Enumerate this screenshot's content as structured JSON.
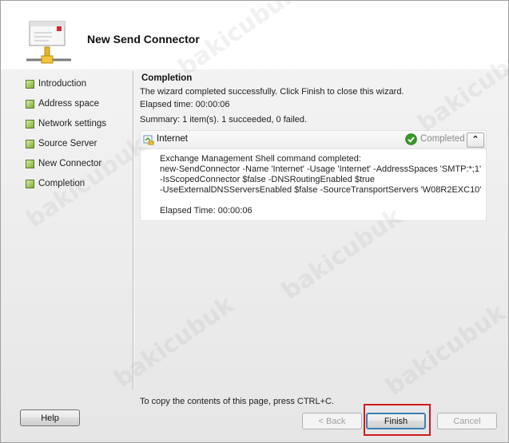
{
  "window": {
    "title": "New Send Connector"
  },
  "steps": [
    {
      "label": "Introduction"
    },
    {
      "label": "Address space"
    },
    {
      "label": "Network settings"
    },
    {
      "label": "Source Server"
    },
    {
      "label": "New Connector"
    },
    {
      "label": "Completion"
    }
  ],
  "completion": {
    "heading": "Completion",
    "message": "The wizard completed successfully. Click Finish to close this wizard.",
    "elapsed": "Elapsed time: 00:00:06",
    "summary": "Summary: 1 item(s). 1 succeeded, 0 failed."
  },
  "result": {
    "name": "Internet",
    "status": "Completed",
    "collapse_glyph": "⌃",
    "lines": [
      "Exchange Management Shell command completed:",
      "new-SendConnector -Name 'Internet' -Usage 'Internet' -AddressSpaces 'SMTP:*;1'",
      "-IsScopedConnector $false -DNSRoutingEnabled $true",
      "-UseExternalDNSServersEnabled $false -SourceTransportServers 'W08R2EXC10'"
    ],
    "elapsed": "Elapsed Time: 00:00:06"
  },
  "copy_hint": "To copy the contents of this page, press CTRL+C.",
  "buttons": {
    "help": "Help",
    "back": "< Back",
    "finish": "Finish",
    "cancel": "Cancel"
  },
  "watermark": "bakicubuk",
  "colors": {
    "highlight": "#d0191b",
    "step_marker": "#7cae3a",
    "status_ok": "#3a9a2a"
  }
}
